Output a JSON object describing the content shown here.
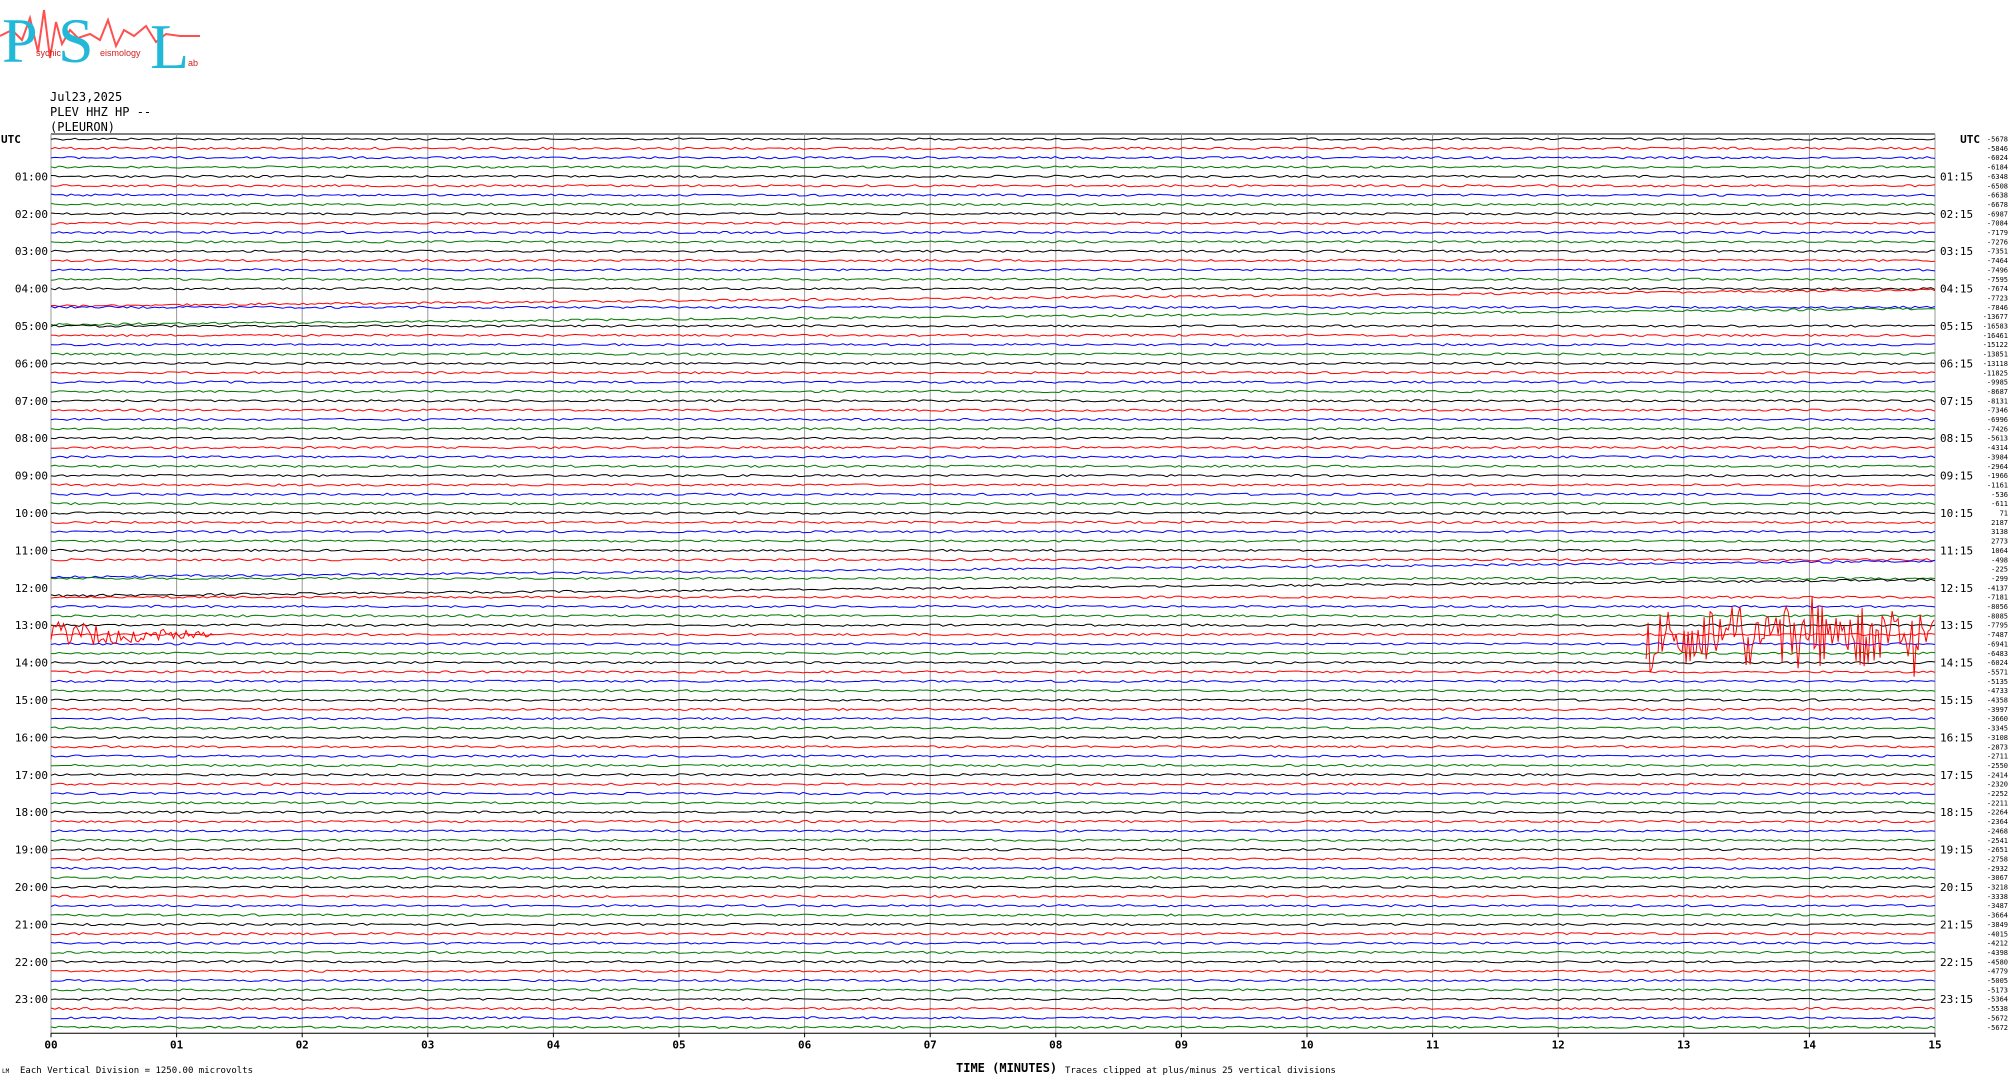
{
  "logo": {
    "letters": [
      "P",
      "S",
      "L"
    ],
    "small_words": [
      "sychic",
      "eismology",
      "ab"
    ]
  },
  "header": {
    "date": "Jul23,2025",
    "channel": "PLEV HHZ HP --",
    "station": "(PLEURON)"
  },
  "corner_left_label": "UTC",
  "corner_right_label": "UTC",
  "footer": {
    "tiny_mark": "LM",
    "scale_note": "Each Vertical Division = 1250.00 microvolts",
    "clip_note": "Traces clipped at plus/minus 25 vertical divisions",
    "xaxis_title": "TIME (MINUTES)"
  },
  "chart_data": {
    "type": "line",
    "title": "",
    "xlabel": "TIME (MINUTES)",
    "xlim": [
      0,
      15
    ],
    "x_ticks": [
      "00",
      "01",
      "02",
      "03",
      "04",
      "05",
      "06",
      "07",
      "08",
      "09",
      "10",
      "11",
      "12",
      "13",
      "14",
      "15"
    ],
    "rows_per_hour": 4,
    "row_count": 96,
    "trace_colors": [
      "#000000",
      "#ff0000",
      "#0000ff",
      "#007a00"
    ],
    "left_hour_labels": [
      "01:00",
      "02:00",
      "03:00",
      "04:00",
      "05:00",
      "06:00",
      "07:00",
      "08:00",
      "09:00",
      "10:00",
      "11:00",
      "12:00",
      "13:00",
      "14:00",
      "15:00",
      "16:00",
      "17:00",
      "18:00",
      "19:00",
      "20:00",
      "21:00",
      "22:00",
      "23:00"
    ],
    "right_hour_labels": [
      "01:15",
      "02:15",
      "03:15",
      "04:15",
      "05:15",
      "06:15",
      "07:15",
      "08:15",
      "09:15",
      "10:15",
      "11:15",
      "12:15",
      "13:15",
      "14:15",
      "15:15",
      "16:15",
      "17:15",
      "18:15",
      "19:15",
      "20:15",
      "21:15",
      "22:15",
      "23:15"
    ],
    "row_offsets": [
      -5678,
      -5846,
      -6024,
      -6184,
      -6348,
      -6508,
      -6638,
      -6678,
      -6987,
      -7084,
      -7179,
      -7276,
      -7351,
      -7464,
      -7496,
      -7595,
      -7674,
      -7723,
      -7846,
      -13677,
      -16583,
      -16461,
      -15122,
      -13851,
      -13118,
      -11825,
      -9985,
      -8687,
      -8131,
      -7346,
      -6996,
      -7426,
      -5613,
      -4314,
      -3984,
      -2964,
      -1966,
      -1161,
      -536,
      -611,
      71,
      2187,
      3138,
      2773,
      1064,
      -498,
      -225,
      -299,
      -4137,
      -7181,
      -8056,
      -8085,
      -7795,
      -7487,
      -6941,
      -6483,
      -6024,
      -5571,
      -5135,
      -4733,
      -4358,
      -3997,
      -3660,
      -3345,
      -3108,
      -2873,
      -2711,
      -2550,
      -2414,
      -2320,
      -2252,
      -2211,
      -2264,
      -2364,
      -2468,
      -2541,
      -2651,
      -2758,
      -2932,
      -3067,
      -3218,
      -3338,
      -3487,
      -3664,
      -3849,
      -4015,
      -4212,
      -4398,
      -4580,
      -4779,
      -5005,
      -5173,
      -5364,
      -5538,
      -5672,
      -5672
    ],
    "events": [
      {
        "row": 53,
        "x_start": 0.0,
        "x_end": 1.3,
        "amplitude": "moderate decaying oscillation"
      },
      {
        "row": 53,
        "x_start": 12.7,
        "x_end": 15.0,
        "amplitude": "large clipped burst"
      }
    ],
    "drifting_rows": [
      {
        "row": 17,
        "from_x": 0,
        "to_x": 15
      },
      {
        "row": 19,
        "from_x": 0,
        "to_x": 15
      },
      {
        "row": 46,
        "from_x": 0,
        "to_x": 15
      },
      {
        "row": 48,
        "from_x": 0,
        "to_x": 15
      }
    ],
    "grid": true
  }
}
